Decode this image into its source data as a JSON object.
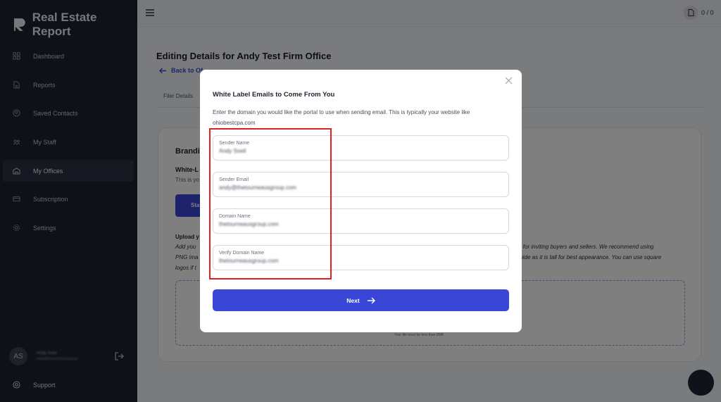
{
  "app": {
    "name": "Real Estate Report"
  },
  "sidebar": {
    "items": [
      {
        "label": "Dashboard",
        "icon": "grid-icon"
      },
      {
        "label": "Reports",
        "icon": "document-icon"
      },
      {
        "label": "Saved Contacts",
        "icon": "contact-icon"
      },
      {
        "label": "My Staff",
        "icon": "people-icon"
      },
      {
        "label": "My Offices",
        "icon": "office-icon"
      },
      {
        "label": "Subscription",
        "icon": "card-icon"
      },
      {
        "label": "Settings",
        "icon": "gear-icon"
      }
    ],
    "active_index": 4,
    "user": {
      "initials": "AS",
      "name": "Andy Soell",
      "email": "andy@thetourneausgroup..."
    },
    "support_label": "Support"
  },
  "topbar": {
    "counter": "0 / 0"
  },
  "page": {
    "title": "Editing Details for Andy Test Firm Office",
    "back_label": "Back to Of",
    "tab_filer": "Filer Details",
    "card": {
      "branding": "Brandi",
      "white_label": "White-L",
      "this_is": "This is yo",
      "start_btn": "Sta",
      "upload": "Upload y",
      "add": "Add you",
      "png": "PNG ima",
      "logos": "logos if t",
      "right1": "il for inviting buyers and sellers. We recommend using",
      "right2": "wide as it is tall for best appearance. You can use square",
      "drop_note": "Your file must be less than 8MB"
    }
  },
  "modal": {
    "title": "White Label Emails to Come From You",
    "desc_line1": "Enter the domain you would like the portal to use when sending email. This is typically your website like",
    "desc_line2": "ohiobestcpa.com",
    "fields": [
      {
        "label": "Sender Name",
        "value": "Andy Soell"
      },
      {
        "label": "Sender Email",
        "value": "andy@thetourneausgroup.com"
      },
      {
        "label": "Domain Name",
        "value": "thetourneausgroup.com"
      },
      {
        "label": "Verify Domain Name",
        "value": "thetourneausgroup.com"
      }
    ],
    "next_label": "Next"
  },
  "colors": {
    "sidebar": "#1d2230",
    "accent": "#3a46d6",
    "highlight": "#e0201c"
  }
}
